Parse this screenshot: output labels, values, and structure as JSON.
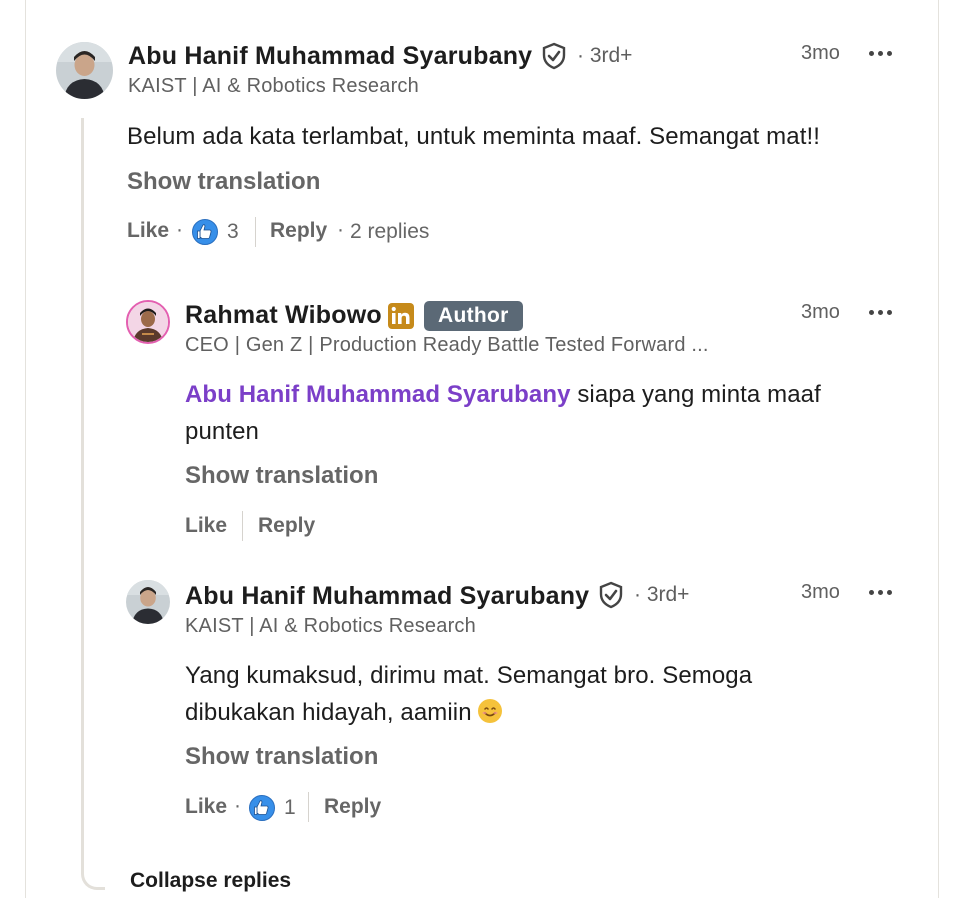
{
  "comments": [
    {
      "author": "Abu Hanif Muhammad Syarubany",
      "degree": "· 3rd+",
      "headline": "KAIST | AI & Robotics Research",
      "time": "3mo",
      "text": "Belum ada kata terlambat, untuk meminta maaf. Semangat mat!!",
      "show_translation": "Show translation",
      "like_label": "Like",
      "reaction_count": "3",
      "reply_label": "Reply",
      "replies_count": "2 replies"
    }
  ],
  "replies": [
    {
      "author": "Rahmat Wibowo",
      "badge": "Author",
      "headline": "CEO | Gen Z | Production Ready Battle Tested Forward ...",
      "time": "3mo",
      "mention": "Abu Hanif Muhammad Syarubany",
      "text_line1": "siapa yang minta maaf",
      "text_line2": "punten",
      "show_translation": "Show translation",
      "like_label": "Like",
      "reply_label": "Reply"
    },
    {
      "author": "Abu Hanif Muhammad Syarubany",
      "degree": "· 3rd+",
      "headline": "KAIST | AI & Robotics Research",
      "time": "3mo",
      "text_line1": "Yang kumaksud, dirimu mat. Semangat bro. Semoga",
      "text_line2": "dibukakan hidayah, aamiin",
      "show_translation": "Show translation",
      "like_label": "Like",
      "reaction_count": "1",
      "reply_label": "Reply"
    }
  ],
  "collapse_label": "Collapse replies",
  "icons": {
    "verified": "verified-shield-icon",
    "more": "more-options-icon",
    "like": "like-reaction-icon",
    "linkedin": "linkedin-icon",
    "smile": "smile-emoji-icon"
  },
  "colors": {
    "mention": "#7b3fc8",
    "author_badge": "#5b6976",
    "like_blue": "#378fe9",
    "linkedin_gold": "#c68a1a"
  }
}
